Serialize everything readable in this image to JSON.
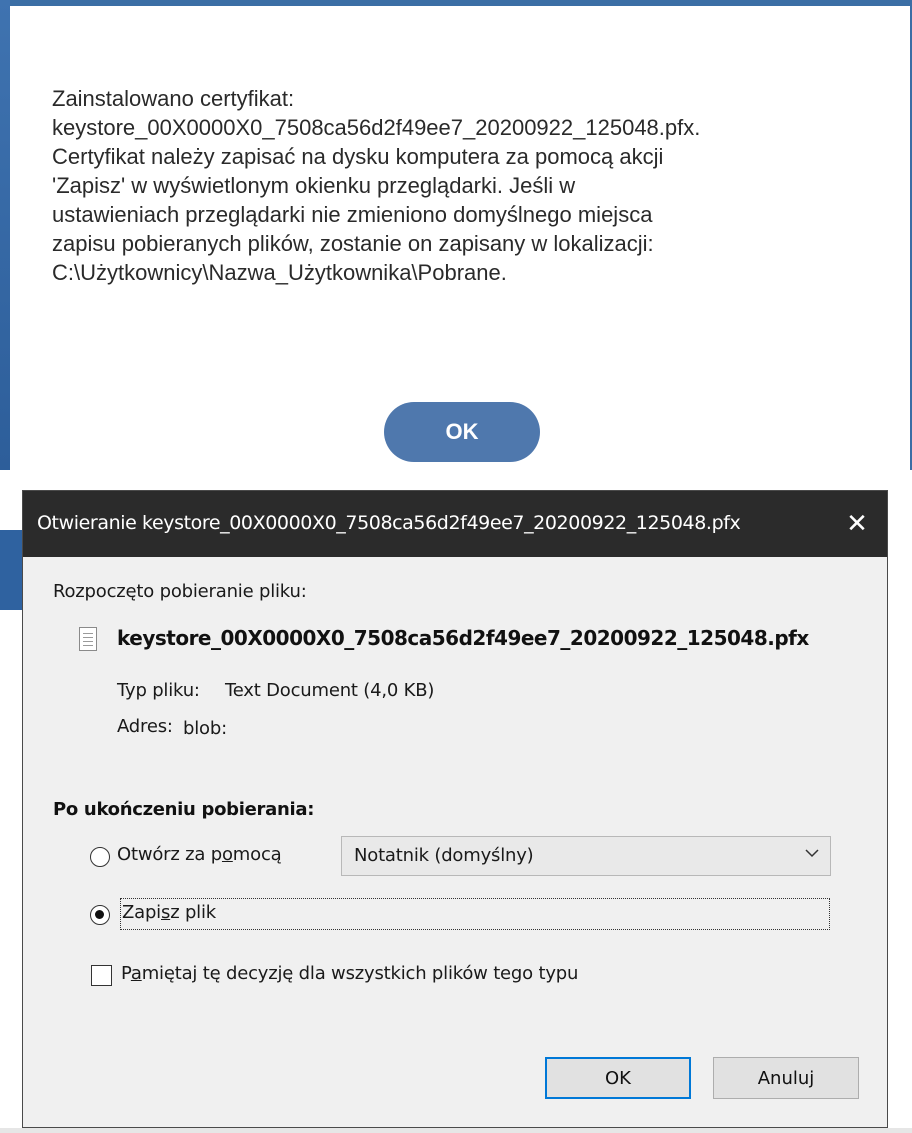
{
  "page": {
    "message": "Zainstalowano certyfikat:\nkeystore_00X0000X0_7508ca56d2f49ee7_20200922_125048.pfx.\nCertyfikat należy zapisać na dysku komputera za pomocą akcji\n'Zapisz' w wyświetlonym okienku przeglądarki. Jeśli w\nustawieniach przeglądarki nie zmieniono domyślnego miejsca\nzapisu pobieranych plików, zostanie on zapisany w lokalizacji:\nC:\\Użytkownicy\\Nazwa_Użytkownika\\Pobrane.",
    "ok_label": "OK"
  },
  "dialog": {
    "title": "Otwieranie keystore_00X0000X0_7508ca56d2f49ee7_20200922_125048.pfx",
    "close_glyph": "✕",
    "started_label": "Rozpoczęto pobieranie pliku:",
    "filename": "keystore_00X0000X0_7508ca56d2f49ee7_20200922_125048.pfx",
    "type_label": "Typ pliku:",
    "type_value": "Text Document (4,0 KB)",
    "address_label": "Adres:",
    "address_value": "blob:",
    "after_download_title": "Po ukończeniu pobierania:",
    "open_with": {
      "pre": "Otwórz za p",
      "accel": "o",
      "post": "mocą",
      "selected": "Notatnik (domyślny)"
    },
    "save_file": {
      "pre": "Zapi",
      "accel": "s",
      "post": "z plik",
      "checked": true
    },
    "remember": {
      "pre": "P",
      "accel": "a",
      "post": "miętaj tę decyzję dla wszystkich plików tego typu",
      "checked": false
    },
    "ok_label": "OK",
    "cancel_label": "Anuluj"
  },
  "colors": {
    "modal_button": "#4f78ad",
    "titlebar": "#2b2b2b",
    "dialog_bg": "#f0f0f0",
    "primary_border": "#0078d7"
  },
  "icons": {
    "file": "text-file-icon",
    "close": "close-icon",
    "dropdown": "chevron-down-icon"
  }
}
